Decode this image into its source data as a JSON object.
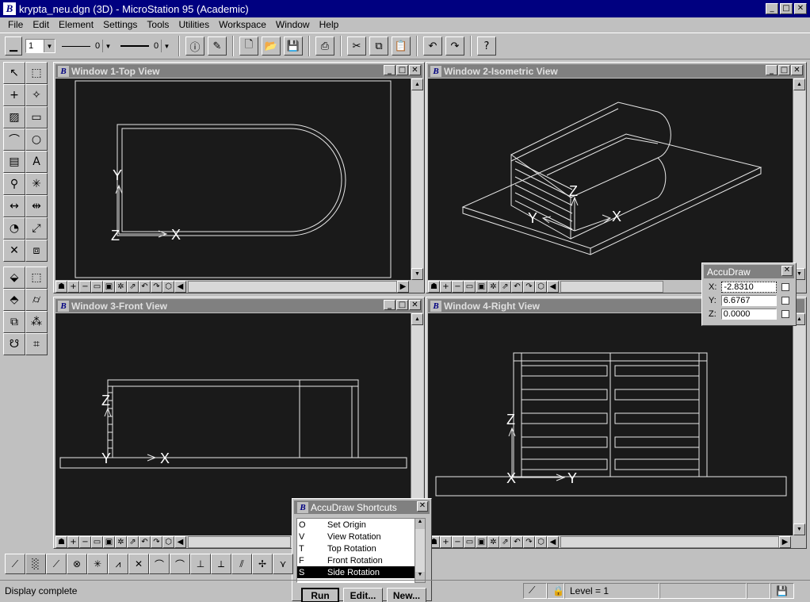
{
  "app": {
    "title": "krypta_neu.dgn (3D) - MicroStation 95 (Academic)"
  },
  "menu": [
    "File",
    "Edit",
    "Element",
    "Settings",
    "Tools",
    "Utilities",
    "Workspace",
    "Window",
    "Help"
  ],
  "toolbar": {
    "level_value": "1",
    "line_weight_value": "0",
    "line_style_value": "0"
  },
  "views": [
    {
      "title": "Window 1-Top View"
    },
    {
      "title": "Window 2-Isometric View"
    },
    {
      "title": "Window 3-Front View"
    },
    {
      "title": "Window 4-Right View"
    }
  ],
  "axes": {
    "x": "X",
    "y": "Y",
    "z": "Z"
  },
  "accudraw": {
    "title": "AccuDraw",
    "x_label": "X:",
    "x_value": "-2.8310",
    "y_label": "Y:",
    "y_value": "6.6767",
    "z_label": "Z:",
    "z_value": "0.0000"
  },
  "shortcuts": {
    "title": "AccuDraw Shortcuts",
    "items": [
      {
        "key": "O",
        "label": "Set Origin"
      },
      {
        "key": "V",
        "label": "View Rotation"
      },
      {
        "key": "T",
        "label": "Top Rotation"
      },
      {
        "key": "F",
        "label": "Front Rotation"
      },
      {
        "key": "S",
        "label": "Side Rotation"
      }
    ],
    "selected_index": 4,
    "run_label": "Run",
    "edit_label": "Edit...",
    "new_label": "New..."
  },
  "status": {
    "message": "Display complete",
    "level": "Level = 1"
  }
}
